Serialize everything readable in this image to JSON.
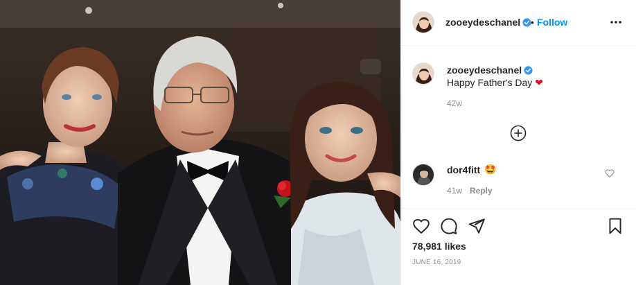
{
  "photo": {
    "alt": "photo of three people at an event"
  },
  "header": {
    "username": "zooeydeschanel",
    "separator": "•",
    "follow_label": "Follow",
    "verified_icon": "verified-badge-icon",
    "more_icon": "more-options-icon"
  },
  "caption": {
    "username": "zooeydeschanel",
    "text": "Happy Father's Day",
    "emoji": "❤",
    "time": "42w"
  },
  "load_more_icon": "plus-circle-icon",
  "comments": [
    {
      "username": "dor4fitt",
      "emoji": "🤩",
      "time": "41w",
      "reply_label": "Reply"
    }
  ],
  "actions": {
    "like_icon": "heart-icon",
    "comment_icon": "comment-icon",
    "share_icon": "share-icon",
    "save_icon": "bookmark-icon"
  },
  "likes": "78,981 likes",
  "date": "JUNE 16, 2019",
  "colors": {
    "link": "#0095f6",
    "verified": "#3897f0",
    "muted": "#8e8e8e",
    "text": "#262626",
    "heart": "#e0102a"
  }
}
